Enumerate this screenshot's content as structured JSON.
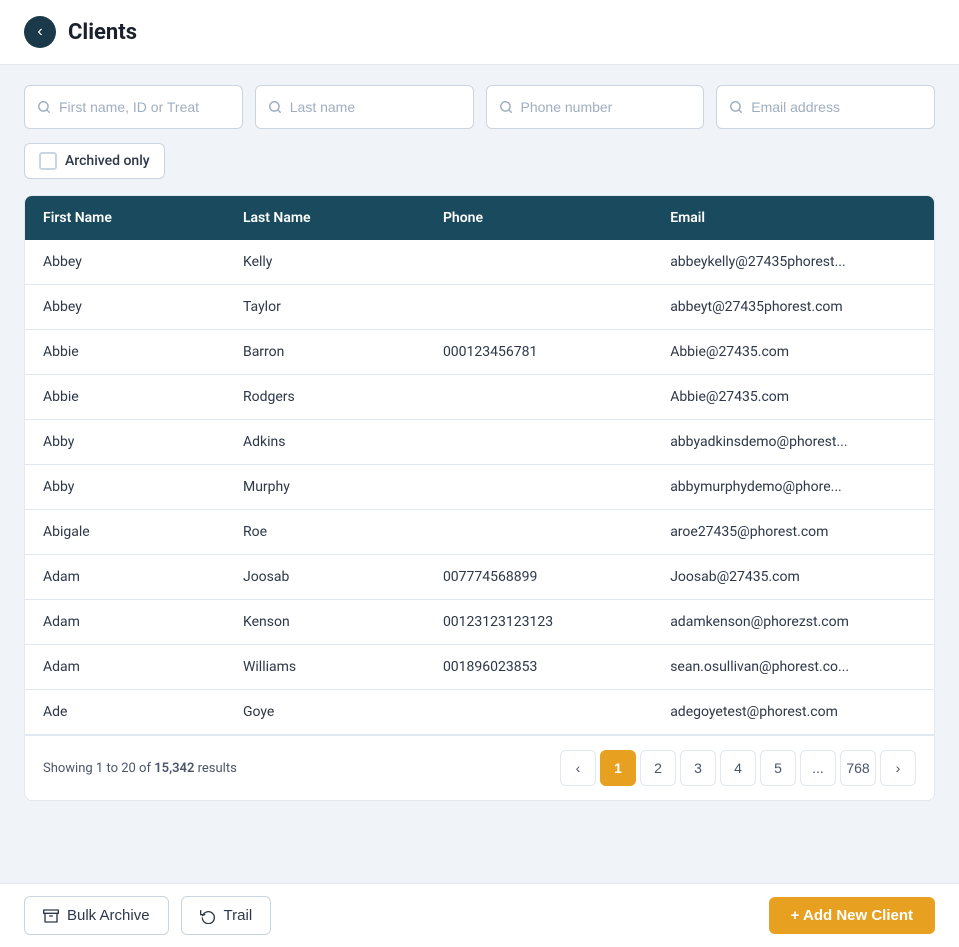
{
  "header": {
    "title": "Clients",
    "back_label": "‹"
  },
  "search": {
    "firstname_placeholder": "First name, ID or Treat",
    "lastname_placeholder": "Last name",
    "phone_placeholder": "Phone number",
    "email_placeholder": "Email address"
  },
  "archived": {
    "label": "Archived only"
  },
  "table": {
    "columns": [
      "First Name",
      "Last Name",
      "Phone",
      "Email"
    ],
    "rows": [
      {
        "firstname": "Abbey",
        "lastname": "Kelly",
        "phone": "",
        "email": "abbeykelly@27435phorest..."
      },
      {
        "firstname": "Abbey",
        "lastname": "Taylor",
        "phone": "",
        "email": "abbeyt@27435phorest.com"
      },
      {
        "firstname": "Abbie",
        "lastname": "Barron",
        "phone": "000123456781",
        "email": "Abbie@27435.com"
      },
      {
        "firstname": "Abbie",
        "lastname": "Rodgers",
        "phone": "",
        "email": "Abbie@27435.com"
      },
      {
        "firstname": "Abby",
        "lastname": "Adkins",
        "phone": "",
        "email": "abbyadkinsdemo@phorest..."
      },
      {
        "firstname": "Abby",
        "lastname": "Murphy",
        "phone": "",
        "email": "abbymurphydemo@phore..."
      },
      {
        "firstname": "Abigale",
        "lastname": "Roe",
        "phone": "",
        "email": "aroe27435@phorest.com"
      },
      {
        "firstname": "Adam",
        "lastname": "Joosab",
        "phone": "007774568899",
        "email": "Joosab@27435.com"
      },
      {
        "firstname": "Adam",
        "lastname": "Kenson",
        "phone": "00123123123123",
        "email": "adamkenson@phorezst.com"
      },
      {
        "firstname": "Adam",
        "lastname": "Williams",
        "phone": "001896023853",
        "email": "sean.osullivan@phorest.co..."
      },
      {
        "firstname": "Ade",
        "lastname": "Goye",
        "phone": "",
        "email": "adegoyetest@phorest.com"
      }
    ]
  },
  "pagination": {
    "showing_prefix": "Showing 1 to 20 of ",
    "total": "15,342",
    "showing_suffix": " results",
    "pages": [
      "1",
      "2",
      "3",
      "4",
      "5",
      "...",
      "768"
    ],
    "current_page": "1"
  },
  "footer": {
    "bulk_archive_label": "Bulk Archive",
    "trail_label": "Trail",
    "add_client_label": "+ Add New Client"
  }
}
